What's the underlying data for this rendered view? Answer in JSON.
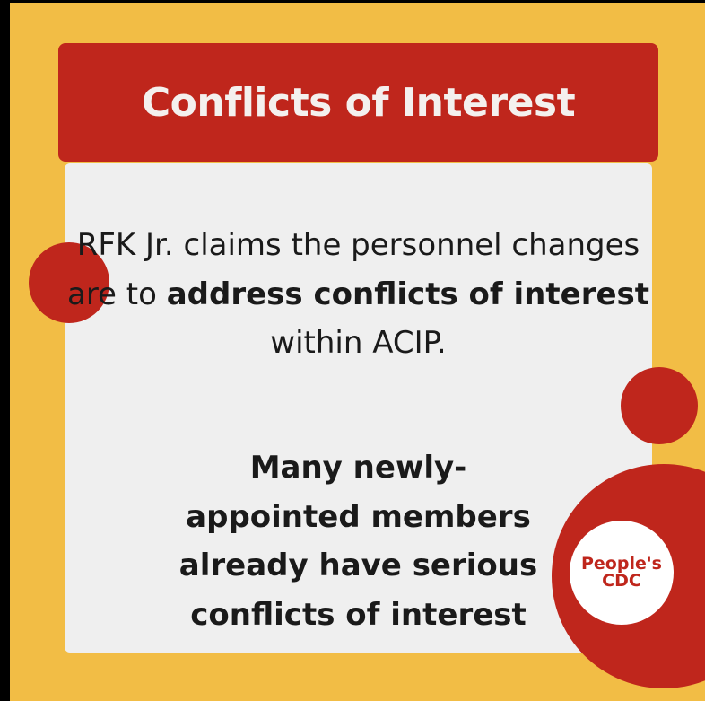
{
  "title": "Conflicts of Interest",
  "body": {
    "p1_a": "RFK Jr. claims the personnel changes are to ",
    "p1_bold": "address conflicts of interest",
    "p1_b": " within ACIP.",
    "p2": "Many newly-appointed members already have serious conflicts of interest"
  },
  "logo": {
    "line1": "People's",
    "line2": "CDC"
  },
  "colors": {
    "red": "#bf261c",
    "yellow": "#f2bd45",
    "panel": "#efefef"
  }
}
